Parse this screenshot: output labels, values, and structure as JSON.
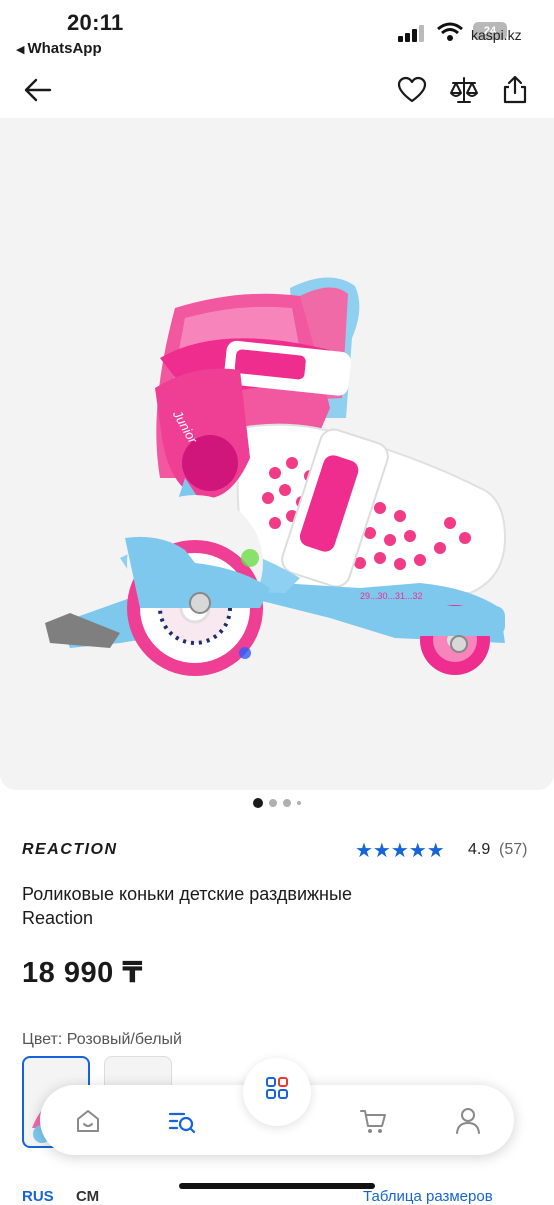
{
  "status": {
    "time": "20:11",
    "back_app": "WhatsApp",
    "battery": "24",
    "url": "kaspi.kz"
  },
  "header": {
    "icons": [
      "arrow-left-icon",
      "heart-icon",
      "scales-icon",
      "share-icon"
    ]
  },
  "gallery": {
    "image_alt": "Роликовые коньки детские раздвижные Reaction",
    "image_label": "Junior",
    "size_marking": "29...30...31...32",
    "pages": 4,
    "active_page": 1
  },
  "product": {
    "brand": "REACTION",
    "rating": "4.9",
    "reviews": "(57)",
    "stars": "★★★★★",
    "title": "Роликовые коньки детские раздвижные Reaction",
    "price": "18 990 ₸",
    "color_label": "Цвет: Розовый/белый"
  },
  "bottom": {
    "lang": "RUS",
    "unit": "СМ",
    "size_table": "Таблица размеров"
  },
  "nav": {
    "items": [
      "home-icon",
      "catalog-search-icon",
      "apps-grid-icon",
      "cart-icon",
      "profile-icon"
    ]
  },
  "colors": {
    "accent": "#1565d8",
    "gallery_bg": "#f3f3f3",
    "skate_pink": "#ef3f95",
    "skate_blue": "#78c6ea"
  }
}
